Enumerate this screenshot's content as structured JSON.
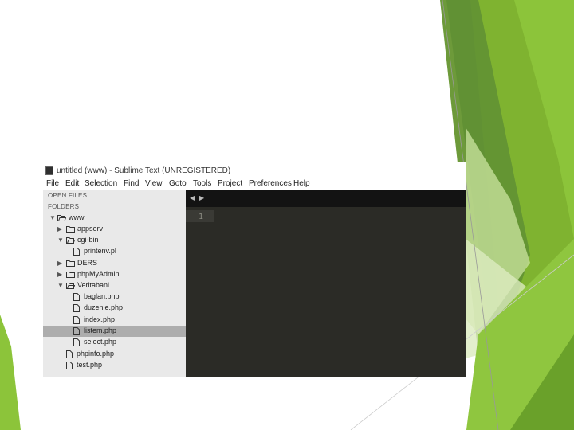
{
  "window": {
    "title": "untitled (www) - Sublime Text (UNREGISTERED)"
  },
  "menu": [
    "File",
    "Edit",
    "Selection",
    "Find",
    "View",
    "Goto",
    "Tools",
    "Project",
    "Preferences",
    "Help"
  ],
  "sidebar": {
    "open_files_label": "OPEN FILES",
    "folders_label": "FOLDERS",
    "tree": [
      {
        "label": "www",
        "type": "folder-open",
        "expanded": true
      },
      {
        "label": "appserv",
        "type": "folder",
        "expanded": false
      },
      {
        "label": "cgi-bin",
        "type": "folder-open",
        "expanded": true
      },
      {
        "label": "printenv.pl",
        "type": "file"
      },
      {
        "label": "DERS",
        "type": "folder",
        "expanded": false
      },
      {
        "label": "phpMyAdmin",
        "type": "folder",
        "expanded": false
      },
      {
        "label": "Veritabani",
        "type": "folder-open",
        "expanded": true
      },
      {
        "label": "baglan.php",
        "type": "file"
      },
      {
        "label": "duzenle.php",
        "type": "file"
      },
      {
        "label": "index.php",
        "type": "file"
      },
      {
        "label": "listem.php",
        "type": "file",
        "selected": true
      },
      {
        "label": "select.php",
        "type": "file"
      },
      {
        "label": "phpinfo.php",
        "type": "file"
      },
      {
        "label": "test.php",
        "type": "file"
      }
    ]
  },
  "editor": {
    "line_number": "1",
    "nav_left": "◀",
    "nav_right": "▶"
  },
  "colors": {
    "editor_bg": "#2b2b26",
    "tabbar_bg": "#131313",
    "sidebar_bg": "#e9e9e9",
    "selected_row": "#adadad",
    "accent_green": "#7ab42f"
  }
}
